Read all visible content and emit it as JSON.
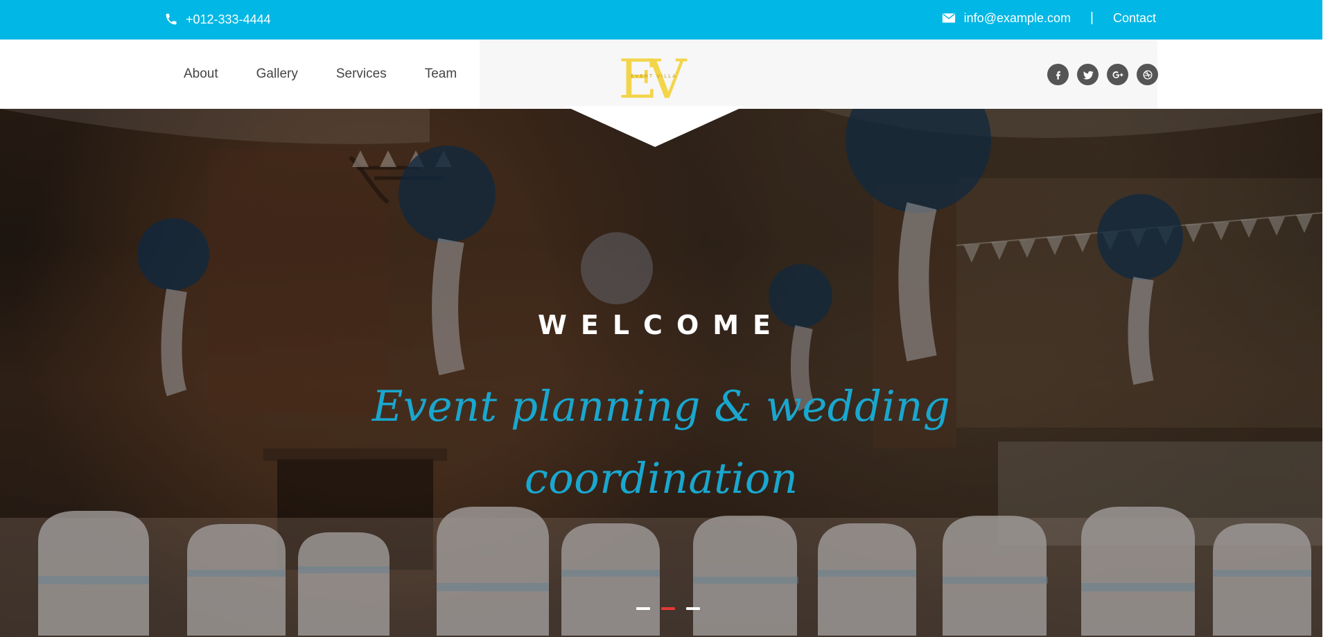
{
  "topbar": {
    "phone_icon": "phone-icon",
    "phone": "+012-333-4444",
    "mail_icon": "mail-icon",
    "email": "info@example.com",
    "separator": "|",
    "contact": "Contact"
  },
  "nav": {
    "items": [
      {
        "label": "About"
      },
      {
        "label": "Gallery"
      },
      {
        "label": "Services"
      },
      {
        "label": "Team"
      }
    ]
  },
  "logo": {
    "monogram": "EV",
    "tagline": "EVENT VILLA"
  },
  "social": {
    "icons": [
      "facebook-icon",
      "twitter-icon",
      "google-plus-icon",
      "dribbble-icon"
    ]
  },
  "hero": {
    "welcome": "WELCOME",
    "headline": "Event planning & wedding coordination"
  },
  "slider": {
    "active_index": 1,
    "count": 3
  },
  "colors": {
    "topbar": "#00b7e5",
    "headline": "#19a7cf",
    "logo": "#f3d54b",
    "active_dot": "#e53935"
  }
}
